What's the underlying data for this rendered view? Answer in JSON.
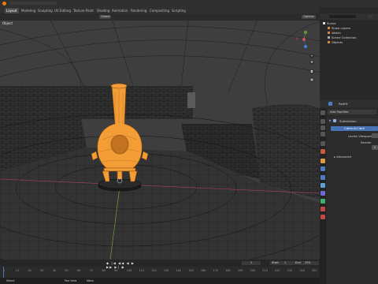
{
  "topbar": {
    "tabs": [
      "Layout",
      "Modeling",
      "Sculpting",
      "UV Editing",
      "Texture Paint",
      "Shading",
      "Animation",
      "Rendering",
      "Compositing",
      "Scripting"
    ],
    "scene_label": "Scene",
    "view_layer_label": "View Layer"
  },
  "viewport": {
    "header": {
      "orientation_value": "Global",
      "options_label": "Options"
    },
    "label": "Object"
  },
  "timeline": {
    "current_frame": "1",
    "start_label": "Start",
    "start_value": "1",
    "end_label": "End",
    "end_value": "250",
    "ruler": [
      "0",
      "10",
      "20",
      "30",
      "40",
      "50",
      "60",
      "70",
      "80",
      "90",
      "100",
      "110",
      "120",
      "130",
      "140",
      "150",
      "160",
      "170",
      "180",
      "190",
      "200",
      "210",
      "220",
      "230",
      "240",
      "250"
    ],
    "status_items": [
      "Select",
      "Pan View",
      "Menu"
    ]
  },
  "outliner": {
    "rows": [
      {
        "label": "Scene",
        "indent": 0
      },
      {
        "label": "Show Layers",
        "indent": 1
      },
      {
        "label": "Watch",
        "indent": 1
      },
      {
        "label": "Scene Collection",
        "indent": 1
      },
      {
        "label": "Objects",
        "indent": 1
      }
    ]
  },
  "properties": {
    "object_name": "RedFit",
    "add_modifier_label": "Add Modifier",
    "modifier_name": "Subdivision",
    "catmull_clark_label": "Catmull-Clark",
    "levels_viewport_label": "Levels Viewport",
    "render_label": "Render",
    "levels_value": "0",
    "advanced_label": "Advanced"
  },
  "colors": {
    "accent": "#f29d35",
    "selected_blue": "#4772b3",
    "wire": "#0a0a0a"
  }
}
